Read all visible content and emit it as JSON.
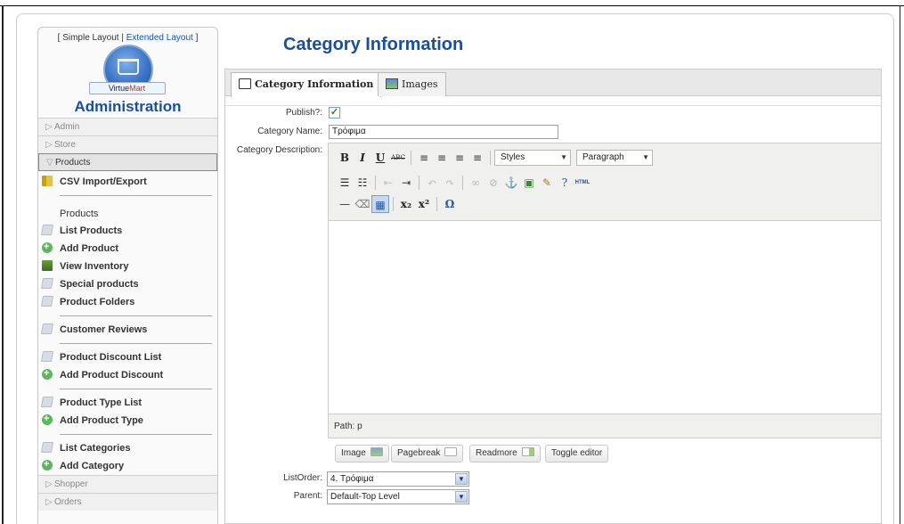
{
  "sidebar": {
    "layout_switch": {
      "open": "[ ",
      "simple": "Simple Layout",
      "divider": " | ",
      "extended": "Extended Layout",
      "close": " ]"
    },
    "logo_text": {
      "virtue": "Virtue",
      "mart": "Mart"
    },
    "title": "Administration",
    "sections": {
      "admin": "Admin",
      "store": "Store",
      "products": "Products",
      "shopper": "Shopper",
      "orders": "Orders"
    },
    "items": {
      "csv": "CSV Import/Export",
      "products_heading": "Products",
      "list_products": "List Products",
      "add_product": "Add Product",
      "view_inventory": "View Inventory",
      "special_products": "Special products",
      "product_folders": "Product Folders",
      "customer_reviews": "Customer Reviews",
      "product_discount_list": "Product Discount List",
      "add_product_discount": "Add Product Discount",
      "product_type_list": "Product Type List",
      "add_product_type": "Add Product Type",
      "list_categories": "List Categories",
      "add_category": "Add Category"
    }
  },
  "main": {
    "title": "Category Information",
    "tabs": {
      "info": "Category Information",
      "images": "Images"
    },
    "form": {
      "publish_label": "Publish?:",
      "publish_checked": "✓",
      "name_label": "Category Name:",
      "name_value": "Τρόφιμα",
      "description_label": "Category Description:",
      "path_text": "Path: p",
      "listorder_label": "ListOrder:",
      "listorder_value": "4. Τρόφιμα",
      "parent_label": "Parent:",
      "parent_value": "Default-Top Level"
    },
    "toolbar": {
      "bold": "B",
      "italic": "I",
      "underline": "U",
      "strike": "ABC",
      "styles": "Styles",
      "paragraph": "Paragraph",
      "html": "HTML",
      "hr": "—",
      "sub": "x₂",
      "sup": "x²",
      "omega": "Ω"
    },
    "buttons": {
      "image": "Image",
      "pagebreak": "Pagebreak",
      "readmore": "Readmore",
      "toggle": "Toggle editor"
    }
  }
}
